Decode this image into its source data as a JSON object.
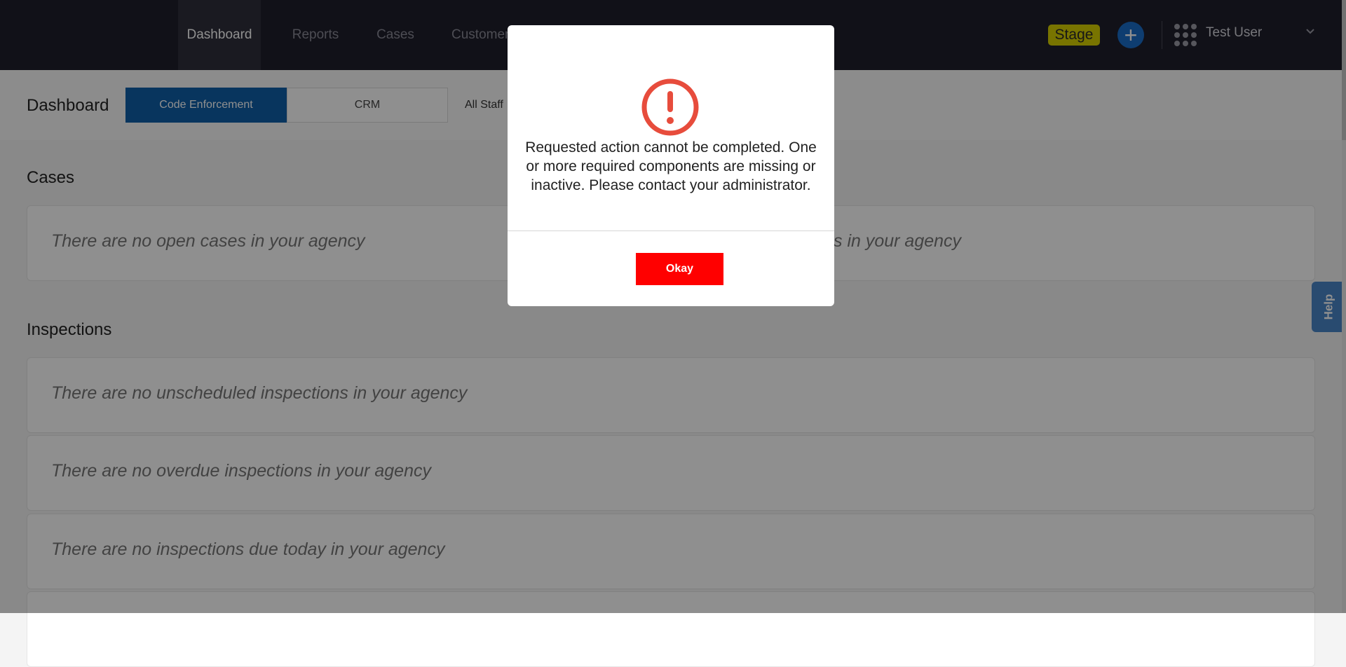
{
  "nav": {
    "items": [
      {
        "label": "Dashboard",
        "active": true
      },
      {
        "label": "Reports",
        "active": false
      },
      {
        "label": "Cases",
        "active": false
      },
      {
        "label": "Customer",
        "active": false
      }
    ],
    "stage_label": "Stage",
    "add_icon": "plus-icon",
    "apps_icon": "apps-grid-icon",
    "user_name": "Test User",
    "user_menu_icon": "chevron-down-icon"
  },
  "subheader": {
    "title": "Dashboard",
    "tabs": [
      {
        "label": "Code Enforcement",
        "active": true
      },
      {
        "label": "CRM",
        "active": false
      }
    ],
    "staff_filter": "All Staff"
  },
  "sections": {
    "cases": {
      "title": "Cases",
      "empty_left": "There are no open cases in your agency",
      "empty_right_partial": "s in your agency"
    },
    "inspections": {
      "title": "Inspections",
      "cards": [
        "There are no unscheduled inspections in your agency",
        "There are no overdue inspections in your agency",
        "There are no inspections due today in your agency"
      ]
    }
  },
  "help_label": "Help",
  "modal": {
    "icon": "alert-circle-icon",
    "message": "Requested action cannot be completed. One or more required components are missing or inactive. Please contact your administrator.",
    "button_label": "Okay"
  },
  "colors": {
    "nav_bg": "#1f1f2b",
    "active_tab": "#0f5fa8",
    "stage_badge": "#d6cf00",
    "alert_red": "#e74c3c",
    "okay_button": "#ff0000"
  }
}
